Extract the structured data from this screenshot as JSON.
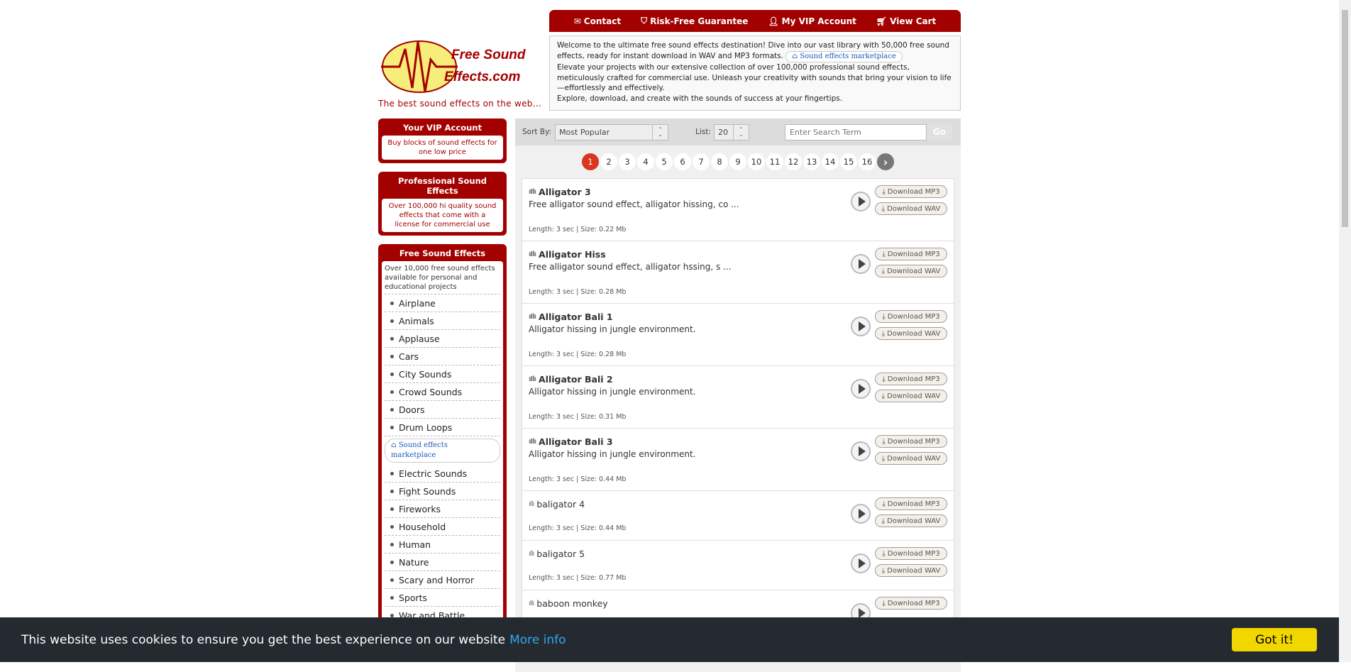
{
  "nav": {
    "contact": "Contact",
    "guarantee": "Risk-Free Guarantee",
    "vip": "My VIP Account",
    "cart": "View Cart"
  },
  "logo": {
    "line1": "Free Sound",
    "line2": "Effects.com"
  },
  "tagline": "The best sound effects on the web...",
  "welcome": {
    "p1": "Welcome to the ultimate free sound effects destination! Dive into our vast library with 50,000 free sound effects, ready for instant download in WAV and MP3 formats.",
    "pill": "Sound effects marketplace",
    "p2": "Elevate your projects with our extensive collection of over 100,000 professional sound effects, meticulously crafted for commercial use. Unleash your creativity with sounds that bring your vision to life—effortlessly and effectively.",
    "p3": "Explore, download, and create with the sounds of success at your fingertips."
  },
  "sidebar": {
    "vip_title": "Your VIP Account",
    "vip_text": "Buy blocks of sound effects for one low price",
    "pro_title": "Professional Sound Effects",
    "pro_text": "Over 100,000 hi quality sound effects that come with a license for commercial use",
    "free_title": "Free Sound Effects",
    "free_text": "Over 10,000 free sound effects available for personal and educational projects",
    "categories_a": [
      "Airplane",
      "Animals",
      "Applause",
      "Cars",
      "City Sounds",
      "Crowd Sounds",
      "Doors",
      "Drum Loops"
    ],
    "marketplace": "Sound effects marketplace",
    "categories_b": [
      "Electric Sounds",
      "Fight Sounds",
      "Fireworks",
      "Household",
      "Human",
      "Nature",
      "Scary and Horror",
      "Sports",
      "War and Battle"
    ]
  },
  "toolbar": {
    "sort_label": "Sort By:",
    "sort_value": "Most Popular",
    "list_label": "List:",
    "list_value": "20",
    "search_placeholder": "Enter Search Term",
    "go": "Go"
  },
  "pager": {
    "pages": [
      "1",
      "2",
      "3",
      "4",
      "5",
      "6",
      "7",
      "8",
      "9",
      "10",
      "11",
      "12",
      "13",
      "14",
      "15",
      "16"
    ],
    "active": "1"
  },
  "buttons": {
    "mp3": "Download MP3",
    "wav": "Download WAV"
  },
  "sounds": [
    {
      "title": "Alligator 3",
      "desc": "Free alligator sound effect, alligator hissing, co ...",
      "meta": "Length: 3 sec | Size: 0.22 Mb"
    },
    {
      "title": "Alligator Hiss",
      "desc": "Free alligator sound effect, alligator hssing, s ...",
      "meta": "Length: 3 sec | Size: 0.28 Mb"
    },
    {
      "title": "Alligator Bali 1",
      "desc": "Alligator hissing in jungle environment.",
      "meta": "Length: 3 sec | Size: 0.28 Mb"
    },
    {
      "title": "Alligator Bali 2",
      "desc": "Alligator hissing in jungle environment.",
      "meta": "Length: 3 sec | Size: 0.31 Mb"
    },
    {
      "title": "Alligator Bali 3",
      "desc": "Alligator hissing in jungle environment.",
      "meta": "Length: 3 sec | Size: 0.44 Mb"
    },
    {
      "title": "baligator 4",
      "desc": "",
      "meta": "Length: 3 sec | Size: 0.44 Mb"
    },
    {
      "title": "baligator 5",
      "desc": "",
      "meta": "Length: 3 sec | Size: 0.77 Mb"
    },
    {
      "title": "baboon monkey",
      "desc": "",
      "meta": ""
    }
  ],
  "cookie": {
    "message": "This website uses cookies to ensure you get the best experience on our website",
    "more": "More info",
    "ok": "Got it!"
  },
  "colors": {
    "brand": "#a30000",
    "active_page": "#d9351f",
    "cookie_bg": "#252a30",
    "cookie_btn": "#f1d600",
    "link": "#31a8f0"
  }
}
